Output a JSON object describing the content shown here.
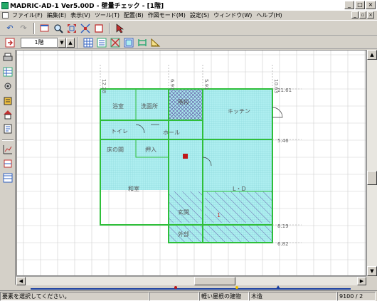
{
  "window": {
    "title": "MADRIC-AD-1 Ver5.00D - 壁量チェック - [1階]",
    "controls": {
      "minimize": "_",
      "maximize": "□",
      "close": "×"
    }
  },
  "menubar": {
    "items": [
      "ファイル(F)",
      "編集(E)",
      "表示(V)",
      "ツール(T)",
      "配置(B)",
      "作図モード(M)",
      "設定(S)",
      "ウィンドウ(W)",
      "ヘルプ(H)"
    ],
    "doc_controls": {
      "minimize": "_",
      "restore": "▫",
      "close": "×"
    }
  },
  "toolbar": {
    "floor_value": "1階",
    "floor_arrow_down": "▼",
    "floor_arrow_up": "▲"
  },
  "plan": {
    "dimensions": {
      "top": [
        "12.28",
        "6.91",
        "5.91",
        "10.63"
      ],
      "right": [
        "21.61",
        "5.46",
        "8.19",
        "6.82"
      ]
    },
    "rooms": {
      "bath": "浴室",
      "washroom": "洗面所",
      "wc": "トイレ",
      "kitchen": "キッチン",
      "hall": "ホール",
      "closet_small": "階段",
      "tokonoma": "床の間",
      "oshiire": "押入",
      "washitsu": "和室",
      "ld": "L・D",
      "storage": "玄関",
      "entrance": "外部"
    },
    "marker_label": "1"
  },
  "statusbar": {
    "message": "要素を選択してください。",
    "roof_type": "軽い屋根の建物",
    "structure": "木造",
    "coords": "9100 / 2"
  },
  "colors": {
    "room_fill": "#aeeef0",
    "wall": "#2fbf3a",
    "grid": "#cfcfcf",
    "hatch": "#6c6cb0"
  }
}
